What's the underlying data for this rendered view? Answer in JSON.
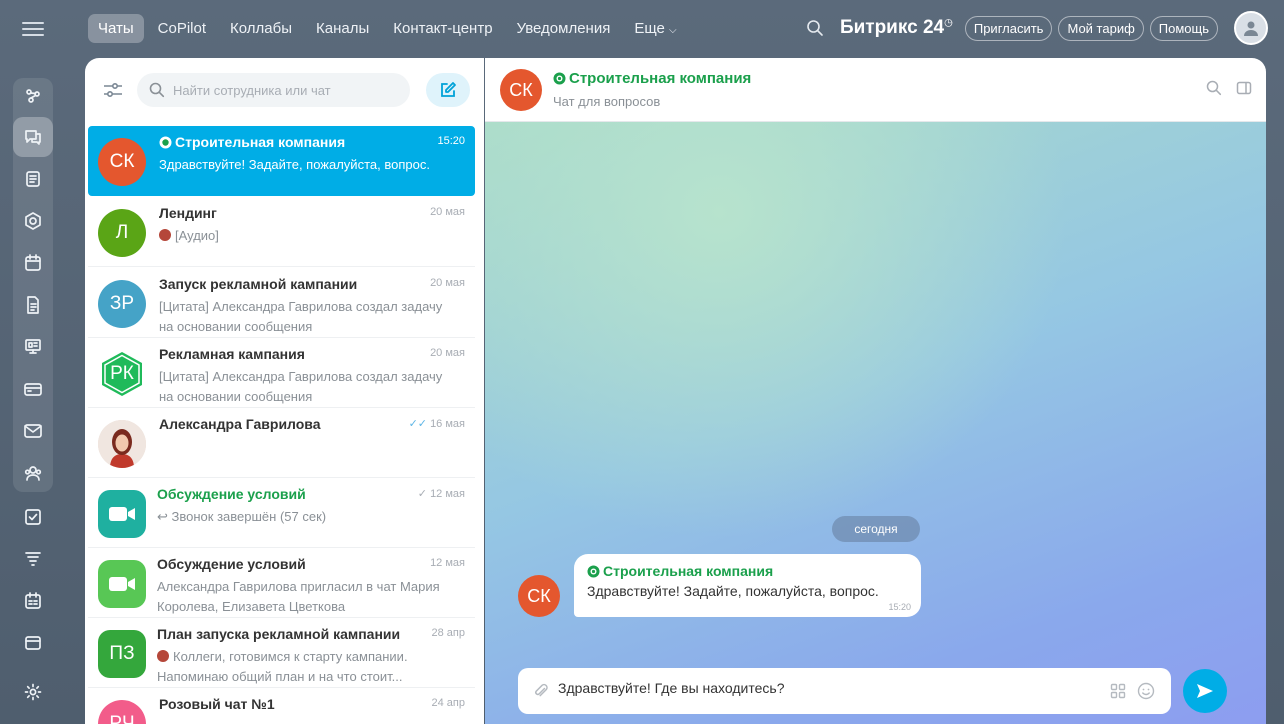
{
  "topbar": {
    "tabs": [
      {
        "label": "Чаты",
        "active": true
      },
      {
        "label": "CoPilot"
      },
      {
        "label": "Коллабы"
      },
      {
        "label": "Каналы"
      },
      {
        "label": "Контакт-центр"
      },
      {
        "label": "Уведомления"
      },
      {
        "label": "Еще"
      }
    ],
    "brand": "Битрикс",
    "brand_number": "24",
    "invite": "Пригласить",
    "tariff": "Мой тариф",
    "help": "Помощь"
  },
  "rail": {
    "icons": [
      "menu-icon",
      "feed-icon",
      "chat-icon",
      "tasks-icon",
      "crm-icon",
      "calendar-icon",
      "documents-icon",
      "boards-icon",
      "sites-icon",
      "mail-icon",
      "contacts-icon",
      "checklist-icon",
      "filter-icon",
      "schedule-icon",
      "window-icon",
      "settings-icon"
    ]
  },
  "list": {
    "search_placeholder": "Найти сотрудника или чат",
    "chats": [
      {
        "initials": "СК",
        "title": "Строительная компания",
        "date": "15:20",
        "preview": "Здравствуйте! Задайте, пожалуйста, вопрос.",
        "color": "#e4572e"
      },
      {
        "initials": "Л",
        "title": "Лендинг",
        "date": "20 мая",
        "preview": "[Аудио]",
        "color": "#5aa516"
      },
      {
        "initials": "ЗР",
        "title": "Запуск рекламной кампании",
        "date": "20 мая",
        "preview": "[Цитата] Александра Гаврилова создал задачу на основании сообщения",
        "color": "#45a3c7"
      },
      {
        "initials": "РК",
        "title": "Рекламная кампания",
        "date": "20 мая",
        "preview": "[Цитата] Александра Гаврилова создал задачу на основании сообщения",
        "color": "#1fba5a"
      },
      {
        "initials": "",
        "title": "Александра Гаврилова",
        "date": "16 мая",
        "preview": "",
        "color": "#b5473a"
      },
      {
        "initials": "",
        "title": "Обсуждение условий",
        "date": "12 мая",
        "preview": "Звонок завершён (57 сек)",
        "color": "#1fb0a0"
      },
      {
        "initials": "",
        "title": "Обсуждение условий",
        "date": "12 мая",
        "preview": "Александра Гаврилова пригласил в чат Мария Королева, Елизавета Цветкова",
        "color": "#58c755"
      },
      {
        "initials": "ПЗ",
        "title": "План запуска рекламной кампании",
        "date": "28 апр",
        "preview": "Коллеги, готовимся к старту кампании. Напоминаю общий план и на что стоит...",
        "color": "#34a73c"
      },
      {
        "initials": "РЧ",
        "title": "Розовый чат №1",
        "date": "24 апр",
        "preview": "",
        "color": "#f25c8a"
      }
    ]
  },
  "conversation": {
    "initials": "СК",
    "title": "Строительная компания",
    "subtitle": "Чат для вопросов",
    "date_divider": "сегодня",
    "message": {
      "author": "Строительная компания",
      "text": "Здравствуйте! Задайте, пожалуйста, вопрос.",
      "time": "15:20"
    },
    "composer_value": "Здравствуйте! Где вы находитесь?"
  }
}
